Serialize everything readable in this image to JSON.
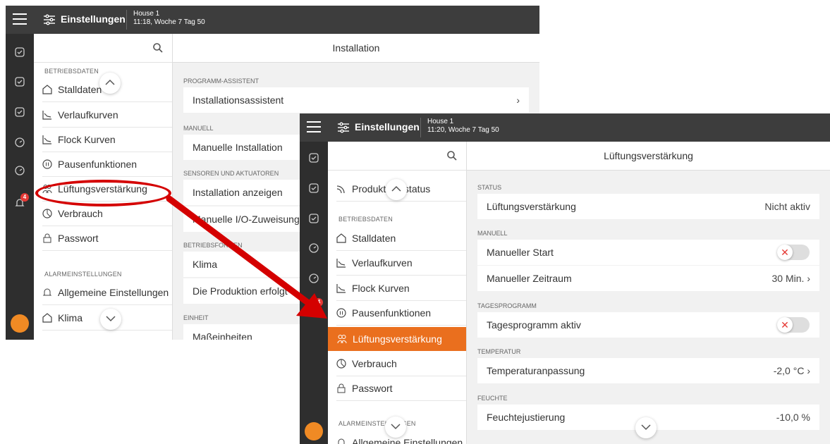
{
  "window1": {
    "header": {
      "title": "Einstellungen",
      "house": "House 1",
      "time": "11:18, Woche 7 Tag 50"
    },
    "sidebar": {
      "sections": [
        {
          "label": "BETRIEBSDATEN"
        },
        {
          "label": "ALARMEINSTELLUNGEN"
        }
      ],
      "items": [
        {
          "label": "Stalldaten"
        },
        {
          "label": "Verlaufkurven"
        },
        {
          "label": "Flock Kurven"
        },
        {
          "label": "Pausenfunktionen"
        },
        {
          "label": "Lüftungsverstärkung"
        },
        {
          "label": "Verbrauch"
        },
        {
          "label": "Passwort"
        },
        {
          "label": "Allgemeine Einstellungen"
        },
        {
          "label": "Klima"
        }
      ]
    },
    "rail": {
      "badge_count": "4"
    },
    "main": {
      "title": "Installation",
      "sections": [
        "PROGRAMM-ASSISTENT",
        "MANUELL",
        "SENSOREN UND AKTUATOREN",
        "BETRIEBSFORMEN",
        "EINHEIT"
      ],
      "rows": [
        "Installationsassistent",
        "Manuelle Installation",
        "Installation anzeigen",
        "Manuelle I/O-Zuweisung",
        "Klima",
        "Die Produktion erfolgt",
        "Maßeinheiten"
      ]
    }
  },
  "window2": {
    "header": {
      "title": "Einstellungen",
      "house": "House 1",
      "time": "11:20, Woche 7 Tag 50"
    },
    "sidebar": {
      "items": [
        {
          "label": "Produktionsstatus"
        },
        {
          "label": "Stalldaten"
        },
        {
          "label": "Verlaufkurven"
        },
        {
          "label": "Flock Kurven"
        },
        {
          "label": "Pausenfunktionen"
        },
        {
          "label": "Lüftungsverstärkung"
        },
        {
          "label": "Verbrauch"
        },
        {
          "label": "Passwort"
        },
        {
          "label": "Allgemeine Einstellungen"
        }
      ],
      "sections": [
        {
          "label": "BETRIEBSDATEN"
        },
        {
          "label": "ALARMEINSTELLUNGEN"
        }
      ]
    },
    "rail": {
      "badge_count": "4"
    },
    "main": {
      "title": "Lüftungsverstärkung",
      "sections": {
        "status": "STATUS",
        "manuell": "MANUELL",
        "tagesprogramm": "TAGESPROGRAMM",
        "temperatur": "TEMPERATUR",
        "feuchte": "FEUCHTE"
      },
      "rows": {
        "status_label": "Lüftungsverstärkung",
        "status_value": "Nicht aktiv",
        "manual_start": "Manueller Start",
        "manual_start_on": false,
        "manual_period": "Manueller Zeitraum",
        "manual_period_value": "30 Min.",
        "day_program": "Tagesprogramm aktiv",
        "day_program_on": false,
        "temp_adjust": "Temperaturanpassung",
        "temp_adjust_value": "-2,0 °C",
        "humidity_adjust": "Feuchtejustierung",
        "humidity_adjust_value": "-10,0 %"
      }
    }
  },
  "colors": {
    "accent": "#ea6f1e",
    "topbar": "#3d3d3d",
    "rail": "#2e2e2e",
    "callout": "#d40000"
  }
}
